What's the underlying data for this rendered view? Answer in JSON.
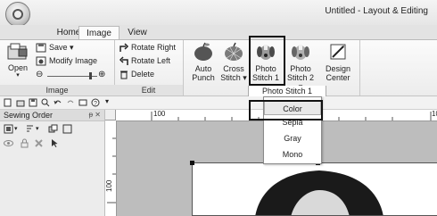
{
  "window": {
    "title": "Untitled - Layout & Editing"
  },
  "tabs": [
    {
      "label": "Home",
      "active": false
    },
    {
      "label": "Image",
      "active": true
    },
    {
      "label": "View",
      "active": false
    }
  ],
  "ribbon": {
    "image_group": {
      "open": "Open",
      "save": "Save",
      "modify": "Modify Image",
      "label": "Image"
    },
    "edit_group": {
      "rotate_right": "Rotate Right",
      "rotate_left": "Rotate Left",
      "delete": "Delete",
      "label": "Edit"
    },
    "auto_punch": {
      "line1": "Auto",
      "line2": "Punch"
    },
    "cross_stitch": {
      "line1": "Cross",
      "line2": "Stitch ▾"
    },
    "photo_stitch_1": {
      "line1": "Photo",
      "line2": "Stitch 1 ▾"
    },
    "photo_stitch_2": {
      "line1": "Photo",
      "line2": "Stitch 2 ▾"
    },
    "design_center": {
      "line1": "Design",
      "line2": "Center"
    },
    "group_tag": "Photo Stitch 1"
  },
  "sewing_order": {
    "title": "Sewing Order",
    "pin": "ᵽ ✕"
  },
  "ruler": {
    "h_100": "100",
    "v_100": "100",
    "h_right": "10"
  },
  "dropdown": {
    "items": [
      "Color",
      "Sepia",
      "Gray",
      "Mono"
    ],
    "selected": "Color"
  },
  "colors": {
    "ribbon_bg": "#f1f1f1",
    "canvas_bg": "#bdbdbd",
    "highlight": "#111111"
  }
}
